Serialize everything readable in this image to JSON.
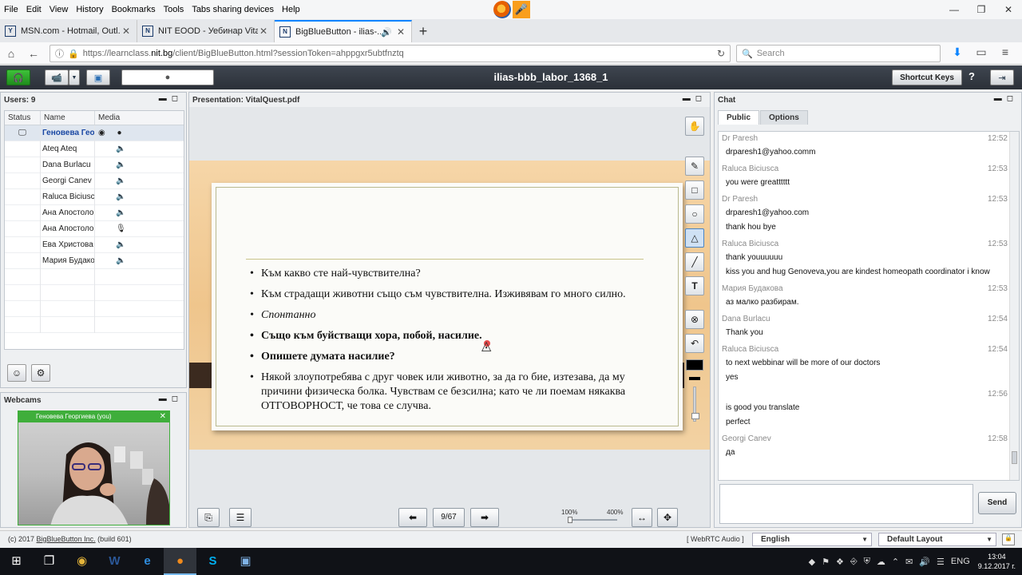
{
  "browser": {
    "menu": [
      "File",
      "Edit",
      "View",
      "History",
      "Bookmarks",
      "Tools",
      "Tabs sharing devices",
      "Help"
    ],
    "window_controls": [
      "—",
      "❐",
      "✕"
    ],
    "tabs": [
      {
        "label": "MSN.com - Hotmail, Outl...",
        "favicon": "Y",
        "active": false
      },
      {
        "label": "NIT EOOD - Уебинар Vita...",
        "favicon": "N",
        "active": false
      },
      {
        "label": "BigBlueButton - ilias-...",
        "favicon": "N",
        "active": true
      }
    ],
    "url_host_prefix": "https://learnclass.",
    "url_host": "nit.bg",
    "url_path": "/client/BigBlueButton.html?sessionToken=ahppgxr5ubtfnztq",
    "search_placeholder": "Search"
  },
  "bbb": {
    "room_title": "ilias-bbb_labor_1368_1",
    "shortcut_keys_label": "Shortcut Keys",
    "help_label": "?"
  },
  "users": {
    "title": "Users: 9",
    "columns": [
      "Status",
      "Name",
      "Media"
    ],
    "rows": [
      {
        "name": "Геновева Гео",
        "me": true
      },
      {
        "name": "Ateq Ateq"
      },
      {
        "name": "Dana Burlacu"
      },
      {
        "name": "Georgi Canev"
      },
      {
        "name": "Raluca Biciusca"
      },
      {
        "name": "Ана Апостолов"
      },
      {
        "name": "Ана Апостолов"
      },
      {
        "name": "Ева Христова"
      },
      {
        "name": "Мария Будаков"
      }
    ]
  },
  "webcams": {
    "title": "Webcams",
    "cam_label": "Геновева Георгиева (you)"
  },
  "presentation": {
    "title": "Presentation: VitalQuest.pdf",
    "page_label": "9/67",
    "zoom_min": "100%",
    "zoom_max": "400%",
    "slide_bullets": [
      {
        "text": "Към какво сте най-чувствителна?",
        "style": ""
      },
      {
        "text": "Към страдащи животни също съм чувствителна. Изживявам го много силно.",
        "style": ""
      },
      {
        "text": "Спонтанно",
        "style": "it"
      },
      {
        "text": "Също към буйстващи хора, побой, насилие.",
        "style": "bd"
      },
      {
        "text": "Опишете думата насилие?",
        "style": "bd"
      },
      {
        "text": "Някой злоупотребява с друг човек или животно, за да го бие, изтезава, да му причини физическа болка. Чувствам се безсилна; като че ли поемам някаква ОТГОВОРНОСТ, че това се случва.",
        "style": ""
      }
    ]
  },
  "chat": {
    "title": "Chat",
    "tabs": [
      "Public",
      "Options"
    ],
    "send_label": "Send",
    "messages": [
      {
        "who": "Dr Paresh",
        "time": "12:52",
        "lines": [
          "drparesh1@yahoo.comm"
        ]
      },
      {
        "who": "Raluca Biciusca",
        "time": "12:53",
        "lines": [
          "you were greatttttt"
        ]
      },
      {
        "who": "Dr Paresh",
        "time": "12:53",
        "lines": [
          "drparesh1@yahoo.com",
          "thank hou bye"
        ]
      },
      {
        "who": "Raluca Biciusca",
        "time": "12:53",
        "lines": [
          "thank youuuuuu",
          "kiss you and hug Genoveva,you are kindest homeopath coordinator i know"
        ]
      },
      {
        "who": "Мария Будакова",
        "time": "12:53",
        "lines": [
          "аз малко разбирам."
        ]
      },
      {
        "who": "Dana Burlacu",
        "time": "12:54",
        "lines": [
          "Thank you"
        ]
      },
      {
        "who": "Raluca Biciusca",
        "time": "12:54",
        "lines": [
          "to next webbinar will be more of our doctors",
          "yes"
        ]
      },
      {
        "who": "",
        "time": "12:56",
        "lines": [
          "is good you translate",
          "perfect"
        ]
      },
      {
        "who": "Georgi Canev",
        "time": "12:58",
        "lines": [
          "да"
        ]
      }
    ]
  },
  "footer": {
    "copyright_prefix": "(c) 2017 ",
    "copyright_link": "BigBlueButton Inc.",
    "copyright_suffix": " (build 601)",
    "webrtc": "[ WebRTC Audio ]",
    "language": "English",
    "layout": "Default Layout"
  },
  "taskbar": {
    "lang": "ENG",
    "time": "13:04",
    "date": "9.12.2017 г."
  }
}
